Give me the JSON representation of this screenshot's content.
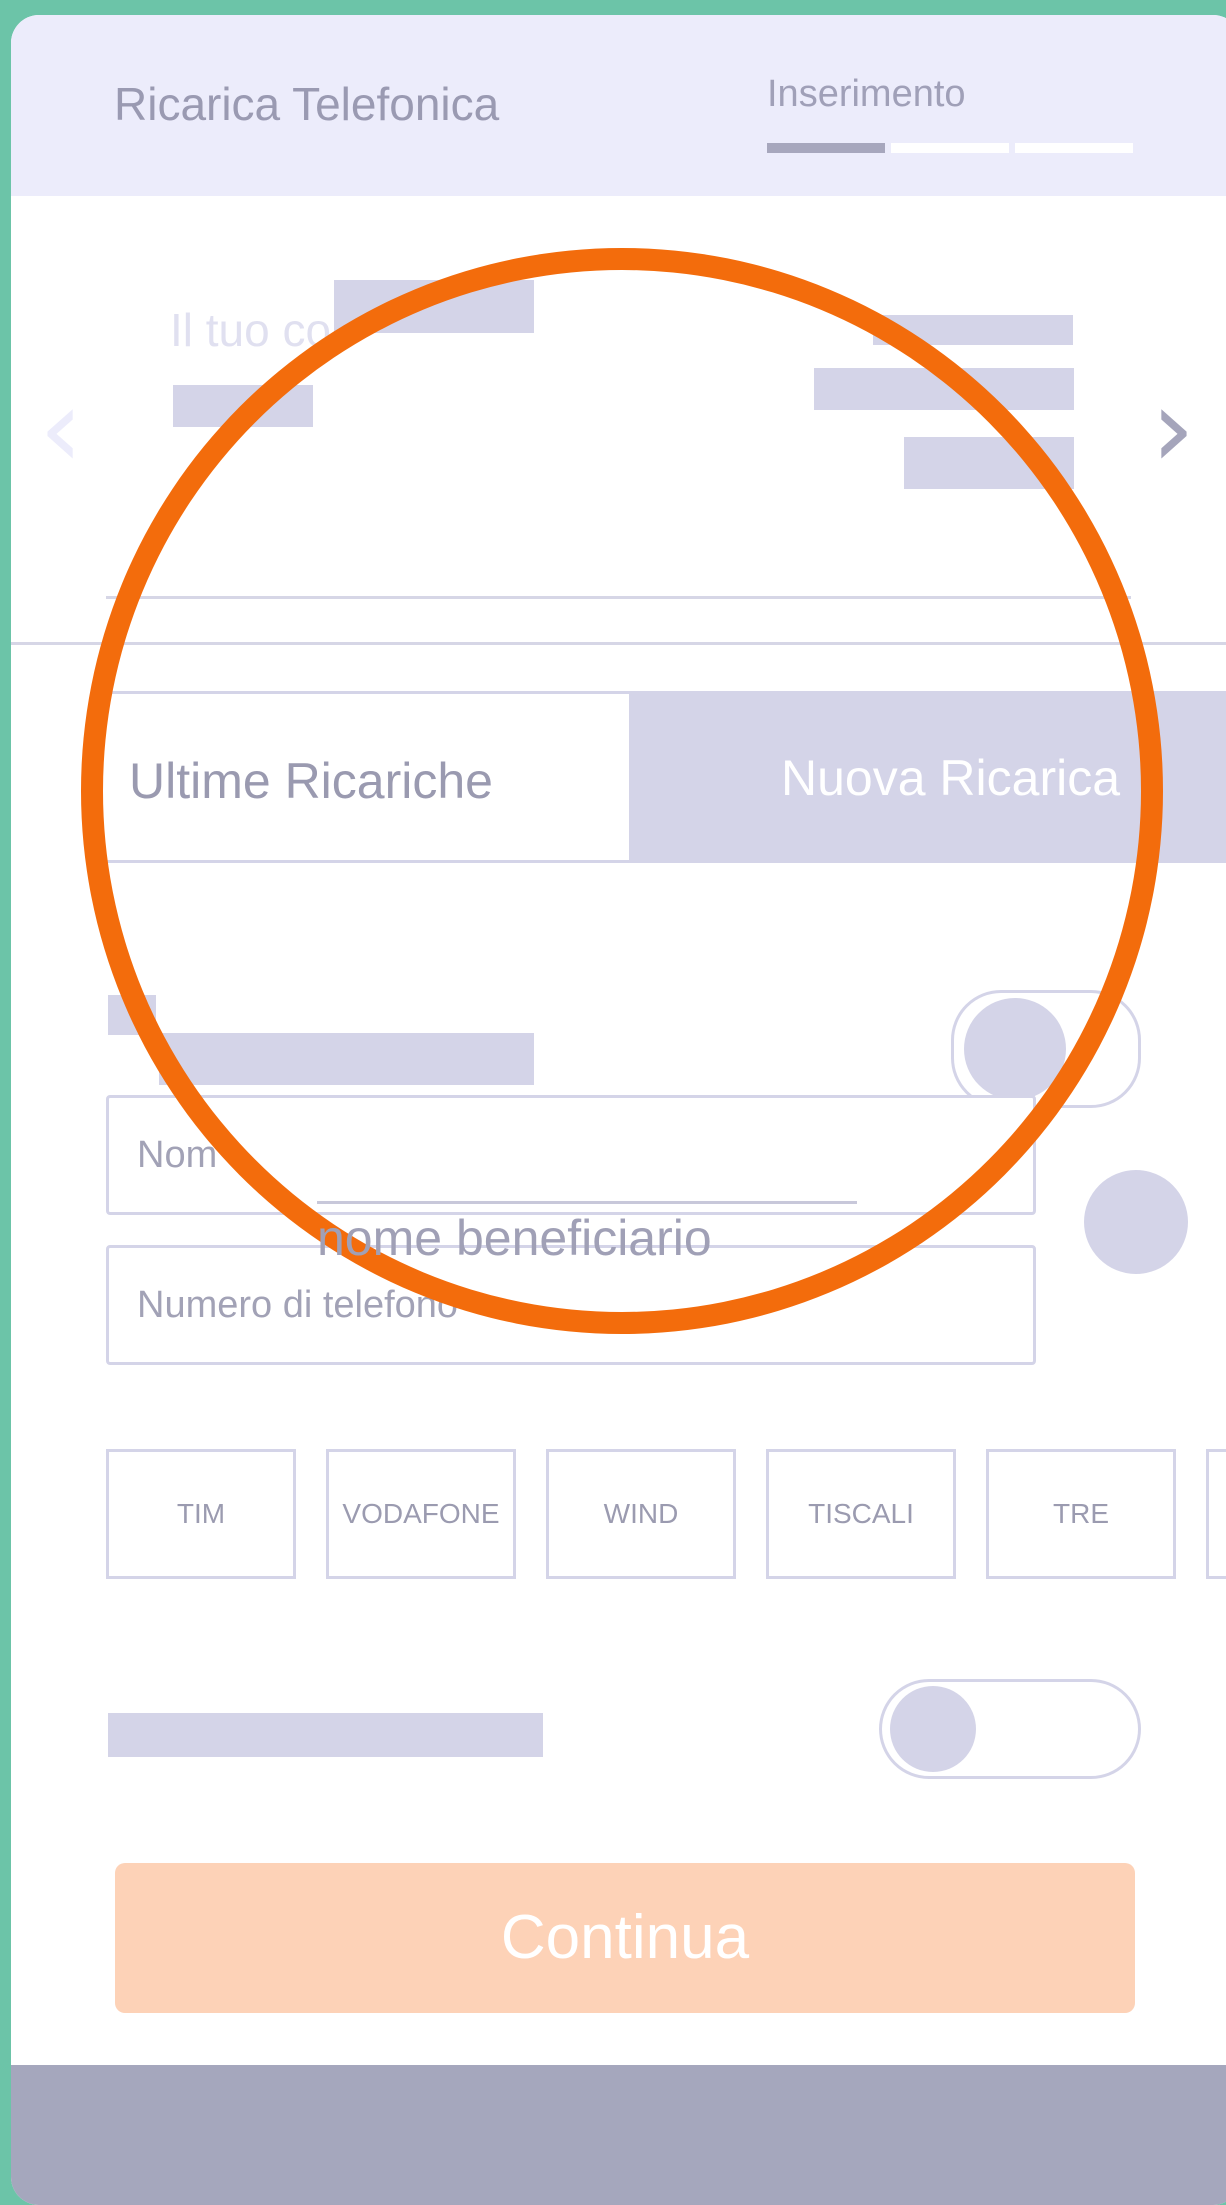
{
  "header": {
    "title": "Ricarica Telefonica",
    "step_label": "Inserimento"
  },
  "account": {
    "label_partial": "Il tuo co"
  },
  "nav": {
    "prev_icon": "chevron-left-icon",
    "next_icon": "chevron-right-icon"
  },
  "tabs": {
    "recent": "Ultime Ricariche",
    "new": "Nuova Ricarica"
  },
  "form": {
    "name_placeholder_partial": "Nom",
    "name_overlay_partial": "nome beneficiario",
    "phone_placeholder": "Numero di telefono"
  },
  "operators": [
    "TIM",
    "VODAFONE",
    "WIND",
    "TISCALI",
    "TRE"
  ],
  "actions": {
    "continue": "Continua"
  },
  "colors": {
    "background": "#6cc4a8",
    "header": "#ececfb",
    "placeholder": "#d4d4e8",
    "accent_ring": "#f36c0c",
    "continue_button": "#fdd2b7",
    "footer": "#a5a7bd"
  }
}
